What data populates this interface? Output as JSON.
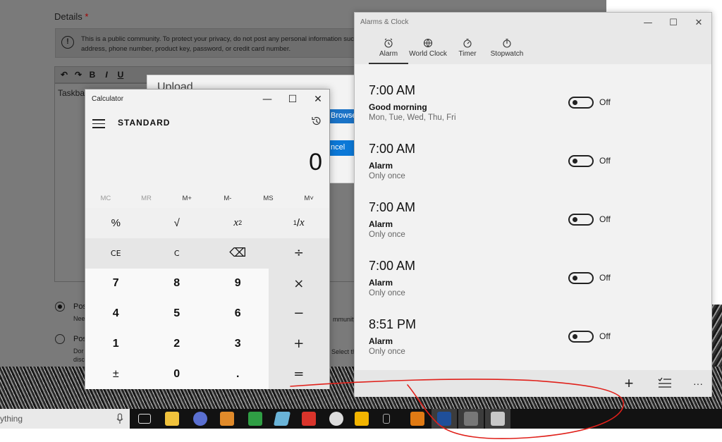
{
  "background_page": {
    "details_label": "Details",
    "required_mark": "*",
    "notice_text": "This is a public community. To protect your privacy, do not post any personal information suc address, phone number, product key, password, or credit card number.",
    "toolbar_format": "Format",
    "editor_text": "Taskbar",
    "radio_option_1": "Pos",
    "radio_option_1_sub": "Nee",
    "radio_option_2": "Pos",
    "radio_option_2_sub": "Dor",
    "radio_option_2_sub2": "disc",
    "community_fragment": "mmunity.",
    "select_fragment": "Select th"
  },
  "upload_dialog": {
    "title": "Upload",
    "browse_label": "Browse",
    "cancel_label": "ncel"
  },
  "taskbar": {
    "search_text": "ything"
  },
  "alarms_app": {
    "window_title": "Alarms & Clock",
    "tabs": [
      {
        "label": "Alarm",
        "icon": "alarm-clock-icon",
        "active": true
      },
      {
        "label": "World Clock",
        "icon": "globe-icon"
      },
      {
        "label": "Timer",
        "icon": "timer-icon"
      },
      {
        "label": "Stopwatch",
        "icon": "stopwatch-icon"
      }
    ],
    "alarms": [
      {
        "time": "7:00 AM",
        "name": "Good morning",
        "days": "Mon, Tue, Wed, Thu, Fri",
        "state": "Off"
      },
      {
        "time": "7:00 AM",
        "name": "Alarm",
        "days": "Only once",
        "state": "Off"
      },
      {
        "time": "7:00 AM",
        "name": "Alarm",
        "days": "Only once",
        "state": "Off"
      },
      {
        "time": "7:00 AM",
        "name": "Alarm",
        "days": "Only once",
        "state": "Off"
      },
      {
        "time": "8:51 PM",
        "name": "Alarm",
        "days": "Only once",
        "state": "Off"
      }
    ],
    "cmd": {
      "add": "+",
      "more": "···"
    }
  },
  "calculator": {
    "window_title": "Calculator",
    "mode": "STANDARD",
    "display": "0",
    "memory": [
      "MC",
      "MR",
      "M+",
      "M-",
      "MS",
      "M˅"
    ],
    "keys": {
      "percent": "%",
      "sqrt": "√",
      "square_base": "x",
      "square_exp": "2",
      "reciprocal_num": "1",
      "reciprocal_den": "x",
      "ce": "CE",
      "c": "C",
      "backspace": "⌫",
      "divide": "÷",
      "seven": "7",
      "eight": "8",
      "nine": "9",
      "multiply": "×",
      "four": "4",
      "five": "5",
      "six": "6",
      "minus": "−",
      "one": "1",
      "two": "2",
      "three": "3",
      "plus": "+",
      "negate": "±",
      "zero": "0",
      "decimal": ".",
      "equals": "="
    }
  },
  "colors": {
    "accent_blue": "#0b78d7",
    "annotation_red": "#e0201a"
  }
}
